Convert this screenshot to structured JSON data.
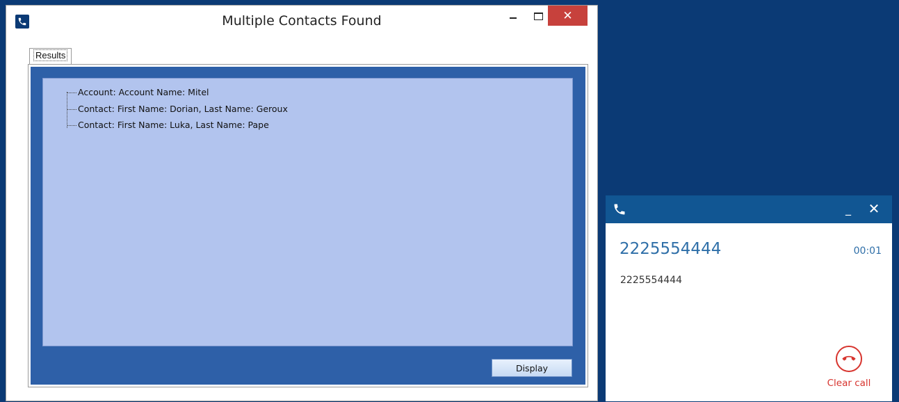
{
  "dialog": {
    "title": "Multiple Contacts Found",
    "close_glyph": "✕",
    "tab_label": "Results",
    "tree_items": [
      "Account: Account Name: Mitel",
      "Contact: First Name: Dorian, Last Name: Geroux",
      "Contact: First Name: Luka, Last Name: Pape"
    ],
    "display_button": "Display"
  },
  "call": {
    "number": "2225554444",
    "timer": "00:01",
    "caller_id": "2225554444",
    "minimize_glyph": "_",
    "close_glyph": "✕",
    "clear_call_label": "Clear call"
  },
  "icons": {
    "app": "phone-icon",
    "call_header": "phone-icon",
    "clear_call": "hang-up-icon"
  },
  "colors": {
    "desktop": "#0b3a75",
    "call_header": "#115693",
    "close_button": "#c7413c",
    "results_bg": "#2e60a8",
    "tree_bg": "#b2c4ee",
    "call_number": "#2f6fa8",
    "clear_call": "#d7342e"
  }
}
